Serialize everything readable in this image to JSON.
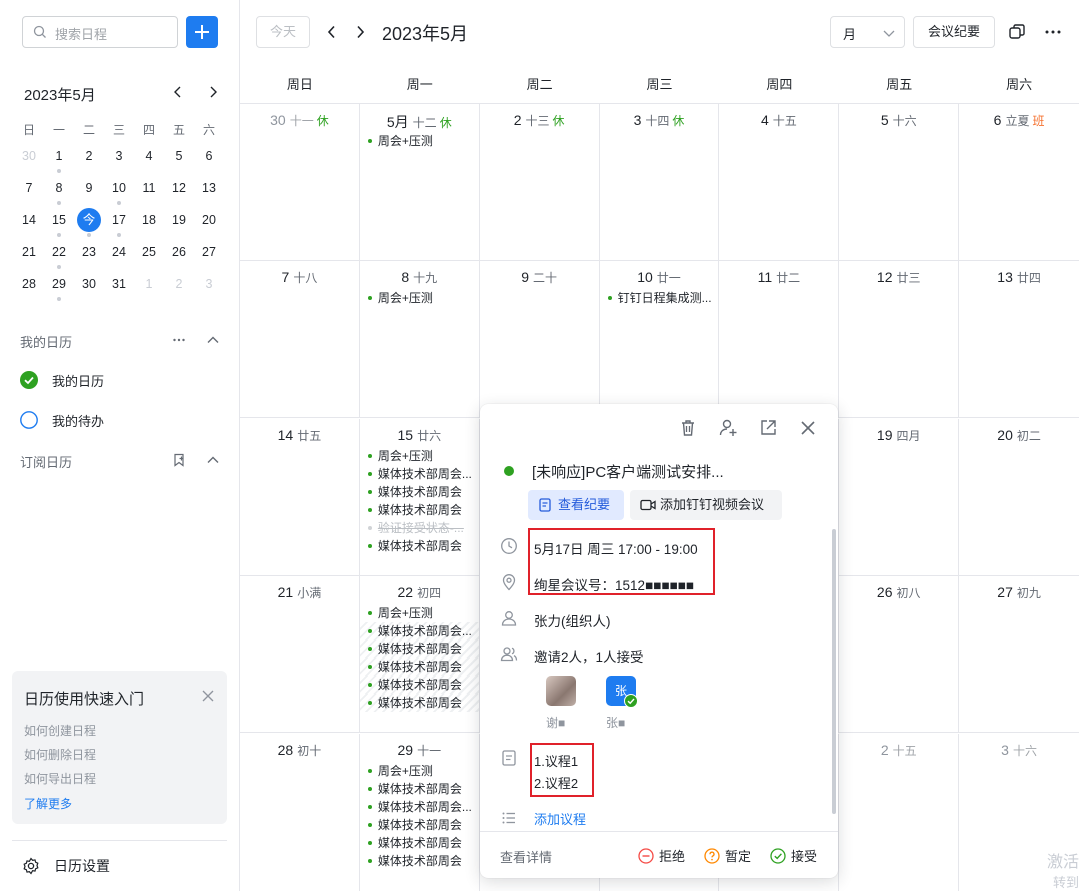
{
  "sidebar": {
    "search_placeholder": "搜索日程",
    "mini_calendar": {
      "title": "2023年5月",
      "weekdays": [
        "日",
        "一",
        "二",
        "三",
        "四",
        "五",
        "六"
      ],
      "weeks": [
        [
          {
            "d": "30",
            "dim": true
          },
          {
            "d": "1",
            "dot": true
          },
          {
            "d": "2"
          },
          {
            "d": "3"
          },
          {
            "d": "4"
          },
          {
            "d": "5"
          },
          {
            "d": "6"
          }
        ],
        [
          {
            "d": "7"
          },
          {
            "d": "8",
            "dot": true
          },
          {
            "d": "9"
          },
          {
            "d": "10",
            "dot": true
          },
          {
            "d": "11"
          },
          {
            "d": "12"
          },
          {
            "d": "13"
          }
        ],
        [
          {
            "d": "14"
          },
          {
            "d": "15",
            "dot": true
          },
          {
            "d": "今",
            "today": true,
            "dot": true
          },
          {
            "d": "17",
            "dot": true
          },
          {
            "d": "18"
          },
          {
            "d": "19"
          },
          {
            "d": "20"
          }
        ],
        [
          {
            "d": "21"
          },
          {
            "d": "22",
            "dot": true
          },
          {
            "d": "23"
          },
          {
            "d": "24"
          },
          {
            "d": "25"
          },
          {
            "d": "26"
          },
          {
            "d": "27"
          }
        ],
        [
          {
            "d": "28"
          },
          {
            "d": "29",
            "dot": true
          },
          {
            "d": "30"
          },
          {
            "d": "31"
          },
          {
            "d": "1",
            "dim": true
          },
          {
            "d": "2",
            "dim": true
          },
          {
            "d": "3",
            "dim": true
          }
        ]
      ]
    },
    "my_calendars_title": "我的日历",
    "my_calendar": "我的日历",
    "my_todo": "我的待办",
    "subscribed_title": "订阅日历",
    "quick_start": {
      "title": "日历使用快速入门",
      "links": [
        "如何创建日程",
        "如何删除日程",
        "如何导出日程"
      ],
      "more": "了解更多"
    },
    "settings": "日历设置"
  },
  "toolbar": {
    "today": "今天",
    "title": "2023年5月",
    "view": "月",
    "minutes": "会议纪要"
  },
  "calendar": {
    "weekdays": [
      "周日",
      "周一",
      "周二",
      "周三",
      "周四",
      "周五",
      "周六"
    ],
    "weeks": [
      [
        {
          "day": "30",
          "lunar": "十一",
          "tag": "休",
          "tag_type": "rest",
          "other": true,
          "events": []
        },
        {
          "day": "5月",
          "lunar": "十二",
          "tag": "休",
          "tag_type": "rest",
          "events": [
            {
              "t": "周会+压测"
            }
          ]
        },
        {
          "day": "2",
          "lunar": "十三",
          "tag": "休",
          "tag_type": "rest",
          "events": []
        },
        {
          "day": "3",
          "lunar": "十四",
          "tag": "休",
          "tag_type": "rest",
          "events": []
        },
        {
          "day": "4",
          "lunar": "十五",
          "events": []
        },
        {
          "day": "5",
          "lunar": "十六",
          "events": []
        },
        {
          "day": "6",
          "lunar": "立夏",
          "tag": "班",
          "tag_type": "work",
          "events": []
        }
      ],
      [
        {
          "day": "7",
          "lunar": "十八",
          "events": []
        },
        {
          "day": "8",
          "lunar": "十九",
          "events": [
            {
              "t": "周会+压测"
            }
          ]
        },
        {
          "day": "9",
          "lunar": "二十",
          "events": []
        },
        {
          "day": "10",
          "lunar": "廿一",
          "events": [
            {
              "t": "钉钉日程集成测..."
            }
          ]
        },
        {
          "day": "11",
          "lunar": "廿二",
          "events": []
        },
        {
          "day": "12",
          "lunar": "廿三",
          "events": []
        },
        {
          "day": "13",
          "lunar": "廿四",
          "events": []
        }
      ],
      [
        {
          "day": "14",
          "lunar": "廿五",
          "events": []
        },
        {
          "day": "15",
          "lunar": "廿六",
          "events": [
            {
              "t": "周会+压测"
            },
            {
              "t": "媒体技术部周会..."
            },
            {
              "t": "媒体技术部周会"
            },
            {
              "t": "媒体技术部周会"
            },
            {
              "t": "验证接受状态-...",
              "muted": true
            },
            {
              "t": "媒体技术部周会"
            }
          ]
        },
        {
          "day": "",
          "lunar": "",
          "events": []
        },
        {
          "day": "",
          "lunar": "",
          "events": []
        },
        {
          "day": "",
          "lunar": "",
          "events": []
        },
        {
          "day": "19",
          "lunar": "四月",
          "events": []
        },
        {
          "day": "20",
          "lunar": "初二",
          "events": []
        }
      ],
      [
        {
          "day": "21",
          "lunar": "小满",
          "events": []
        },
        {
          "day": "22",
          "lunar": "初四",
          "events": [
            {
              "t": "周会+压测"
            },
            {
              "t": "媒体技术部周会...",
              "hatch": true
            },
            {
              "t": "媒体技术部周会",
              "hatch": true
            },
            {
              "t": "媒体技术部周会",
              "hatch": true
            },
            {
              "t": "媒体技术部周会",
              "hatch": true
            },
            {
              "t": "媒体技术部周会",
              "hatch": true
            }
          ]
        },
        {
          "day": "",
          "lunar": "",
          "events": []
        },
        {
          "day": "",
          "lunar": "",
          "events": []
        },
        {
          "day": "",
          "lunar": "",
          "events": []
        },
        {
          "day": "26",
          "lunar": "初八",
          "events": []
        },
        {
          "day": "27",
          "lunar": "初九",
          "events": []
        }
      ],
      [
        {
          "day": "28",
          "lunar": "初十",
          "events": []
        },
        {
          "day": "29",
          "lunar": "十一",
          "events": [
            {
              "t": "周会+压测"
            },
            {
              "t": "媒体技术部周会"
            },
            {
              "t": "媒体技术部周会..."
            },
            {
              "t": "媒体技术部周会"
            },
            {
              "t": "媒体技术部周会"
            },
            {
              "t": "媒体技术部周会"
            }
          ]
        },
        {
          "day": "",
          "lunar": "",
          "events": []
        },
        {
          "day": "",
          "lunar": "",
          "events": []
        },
        {
          "day": "",
          "lunar": "",
          "events": []
        },
        {
          "day": "2",
          "lunar": "十五",
          "other": true,
          "events": []
        },
        {
          "day": "3",
          "lunar": "十六",
          "other": true,
          "events": []
        }
      ]
    ]
  },
  "popup": {
    "title": "[未响应]PC客户端测试安排...",
    "view_minutes": "查看纪要",
    "add_video": "添加钉钉视频会议",
    "time": "5月17日 周三 17:00 - 19:00",
    "location": "绚星会议号：1512■■■■■■",
    "organizer": "张力(组织人)",
    "invite_summary": "邀请2人，1人接受",
    "attendees": [
      {
        "name": "谢■",
        "avatar_text": ""
      },
      {
        "name": "张■",
        "avatar_text": "张"
      }
    ],
    "agenda": [
      "1.议程1",
      "2.议程2"
    ],
    "add_agenda": "添加议程",
    "view_details": "查看详情",
    "decline": "拒绝",
    "tentative": "暂定",
    "accept": "接受"
  },
  "watermark": [
    "激活",
    "转到"
  ],
  "colors": {
    "accent": "#1e7cf0",
    "event_dot": "#2ea121",
    "rest": "#2ea121",
    "work": "#f5712f",
    "highlight_box": "#e0212a"
  }
}
